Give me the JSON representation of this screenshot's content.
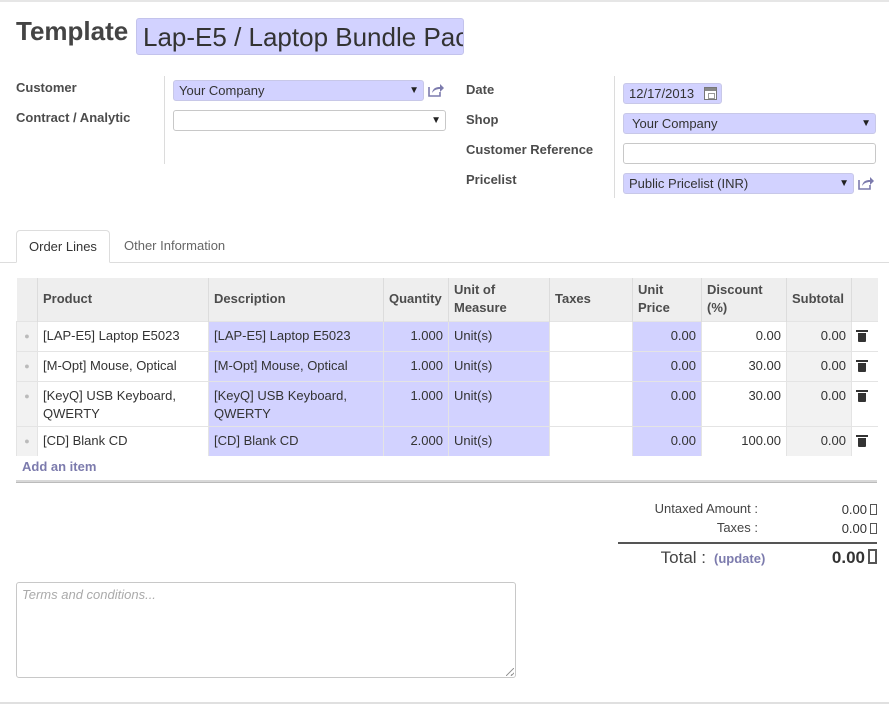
{
  "header": {
    "title_label": "Template",
    "title_value": "Lap-E5 / Laptop Bundle Pac"
  },
  "form": {
    "customer_label": "Customer",
    "customer_value": "Your Company",
    "contract_label": "Contract / Analytic",
    "contract_value": "",
    "date_label": "Date",
    "date_value": "12/17/2013",
    "shop_label": "Shop",
    "shop_value": "Your Company",
    "customer_ref_label": "Customer Reference",
    "customer_ref_value": "",
    "pricelist_label": "Pricelist",
    "pricelist_value": "Public Pricelist (INR)"
  },
  "tabs": [
    {
      "label": "Order Lines",
      "active": true
    },
    {
      "label": "Other Information",
      "active": false
    }
  ],
  "order_lines": {
    "columns": [
      "Product",
      "Description",
      "Quantity",
      "Unit of Measure",
      "Taxes",
      "Unit Price",
      "Discount (%)",
      "Subtotal"
    ],
    "rows": [
      {
        "product": "[LAP-E5] Laptop E5023",
        "description": "[LAP-E5] Laptop E5023",
        "quantity": "1.000",
        "uom": "Unit(s)",
        "taxes": "",
        "unit_price": "0.00",
        "discount": "0.00",
        "subtotal": "0.00"
      },
      {
        "product": "[M-Opt] Mouse, Optical",
        "description": "[M-Opt] Mouse, Optical",
        "quantity": "1.000",
        "uom": "Unit(s)",
        "taxes": "",
        "unit_price": "0.00",
        "discount": "30.00",
        "subtotal": "0.00"
      },
      {
        "product": "[KeyQ] USB Keyboard, QWERTY",
        "description": "[KeyQ] USB Keyboard, QWERTY",
        "quantity": "1.000",
        "uom": "Unit(s)",
        "taxes": "",
        "unit_price": "0.00",
        "discount": "30.00",
        "subtotal": "0.00"
      },
      {
        "product": "[CD] Blank CD",
        "description": "[CD] Blank CD",
        "quantity": "2.000",
        "uom": "Unit(s)",
        "taxes": "",
        "unit_price": "0.00",
        "discount": "100.00",
        "subtotal": "0.00"
      }
    ],
    "add_item_label": "Add an item"
  },
  "totals": {
    "untaxed_label": "Untaxed Amount :",
    "untaxed_value": "0.00",
    "taxes_label": "Taxes :",
    "taxes_value": "0.00",
    "total_label": "Total :",
    "update_label": "(update)",
    "total_value": "0.00"
  },
  "terms": {
    "placeholder": "Terms and conditions..."
  },
  "icons": {
    "external_link": "external-link-icon",
    "calendar": "calendar-icon",
    "delete": "trash-icon",
    "dropdown": "chevron-down-icon",
    "drag_handle": "drag-handle-icon"
  },
  "colors": {
    "required_field": "#d2d2ff",
    "link": "#7c7bad"
  }
}
